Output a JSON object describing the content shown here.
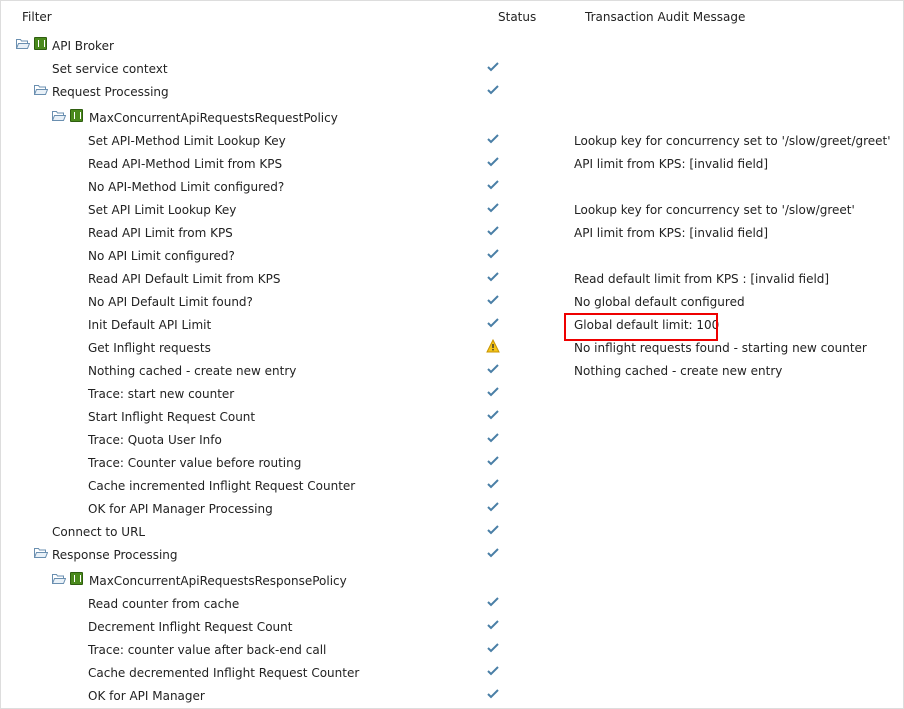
{
  "header": {
    "filter": "Filter",
    "status": "Status",
    "message": "Transaction Audit Message"
  },
  "colors": {
    "check": "#4a7fa6",
    "warning": "#e8b400",
    "highlight": "#e00000",
    "policy_icon": "#4a8a1c"
  },
  "rows": [
    {
      "label": "API Broker",
      "level": 0,
      "type": "policy-root",
      "status": "",
      "message": ""
    },
    {
      "label": "Set service context",
      "level": 1,
      "type": "item",
      "status": "check",
      "message": ""
    },
    {
      "label": "Request Processing",
      "level": 1,
      "type": "folder",
      "status": "check",
      "message": ""
    },
    {
      "label": "MaxConcurrentApiRequestsRequestPolicy",
      "level": 2,
      "type": "policy",
      "status": "",
      "message": ""
    },
    {
      "label": "Set API-Method Limit Lookup Key",
      "level": 3,
      "type": "item",
      "status": "check",
      "message": "Lookup key for concurrency set to '/slow/greet/greet'"
    },
    {
      "label": "Read API-Method Limit from KPS",
      "level": 3,
      "type": "item",
      "status": "check",
      "message": "API limit from KPS: [invalid field]"
    },
    {
      "label": "No API-Method Limit configured?",
      "level": 3,
      "type": "item",
      "status": "check",
      "message": ""
    },
    {
      "label": "Set API Limit Lookup Key",
      "level": 3,
      "type": "item",
      "status": "check",
      "message": "Lookup key for concurrency set to '/slow/greet'"
    },
    {
      "label": "Read API Limit from KPS",
      "level": 3,
      "type": "item",
      "status": "check",
      "message": "API limit from KPS: [invalid field]"
    },
    {
      "label": "No API Limit configured?",
      "level": 3,
      "type": "item",
      "status": "check",
      "message": ""
    },
    {
      "label": "Read API Default Limit from KPS",
      "level": 3,
      "type": "item",
      "status": "check",
      "message": "Read default limit from KPS : [invalid field]"
    },
    {
      "label": "No API Default Limit found?",
      "level": 3,
      "type": "item",
      "status": "check",
      "message": "No global default configured"
    },
    {
      "label": "Init Default API Limit",
      "level": 3,
      "type": "item",
      "status": "check",
      "message": "Global default limit: 100"
    },
    {
      "label": "Get Inflight requests",
      "level": 3,
      "type": "item",
      "status": "warning",
      "message": "No inflight requests found - starting new counter"
    },
    {
      "label": "Nothing cached - create new entry",
      "level": 3,
      "type": "item",
      "status": "check",
      "message": "Nothing cached - create new entry"
    },
    {
      "label": "Trace: start new counter",
      "level": 3,
      "type": "item",
      "status": "check",
      "message": ""
    },
    {
      "label": "Start Inflight Request Count",
      "level": 3,
      "type": "item",
      "status": "check",
      "message": ""
    },
    {
      "label": "Trace: Quota User Info",
      "level": 3,
      "type": "item",
      "status": "check",
      "message": ""
    },
    {
      "label": "Trace: Counter value before routing",
      "level": 3,
      "type": "item",
      "status": "check",
      "message": ""
    },
    {
      "label": "Cache incremented Inflight Request Counter",
      "level": 3,
      "type": "item",
      "status": "check",
      "message": ""
    },
    {
      "label": "OK for API Manager Processing",
      "level": 3,
      "type": "item",
      "status": "check",
      "message": ""
    },
    {
      "label": "Connect to URL",
      "level": 1,
      "type": "item",
      "status": "check",
      "message": ""
    },
    {
      "label": "Response Processing",
      "level": 1,
      "type": "folder",
      "status": "check",
      "message": ""
    },
    {
      "label": "MaxConcurrentApiRequestsResponsePolicy",
      "level": 2,
      "type": "policy",
      "status": "",
      "message": ""
    },
    {
      "label": "Read counter from cache",
      "level": 3,
      "type": "item",
      "status": "check",
      "message": ""
    },
    {
      "label": "Decrement Inflight Request Count",
      "level": 3,
      "type": "item",
      "status": "check",
      "message": ""
    },
    {
      "label": "Trace: counter value after back-end call",
      "level": 3,
      "type": "item",
      "status": "check",
      "message": ""
    },
    {
      "label": "Cache decremented Inflight Request Counter",
      "level": 3,
      "type": "item",
      "status": "check",
      "message": ""
    },
    {
      "label": "OK for API Manager",
      "level": 3,
      "type": "item",
      "status": "check",
      "message": ""
    }
  ]
}
